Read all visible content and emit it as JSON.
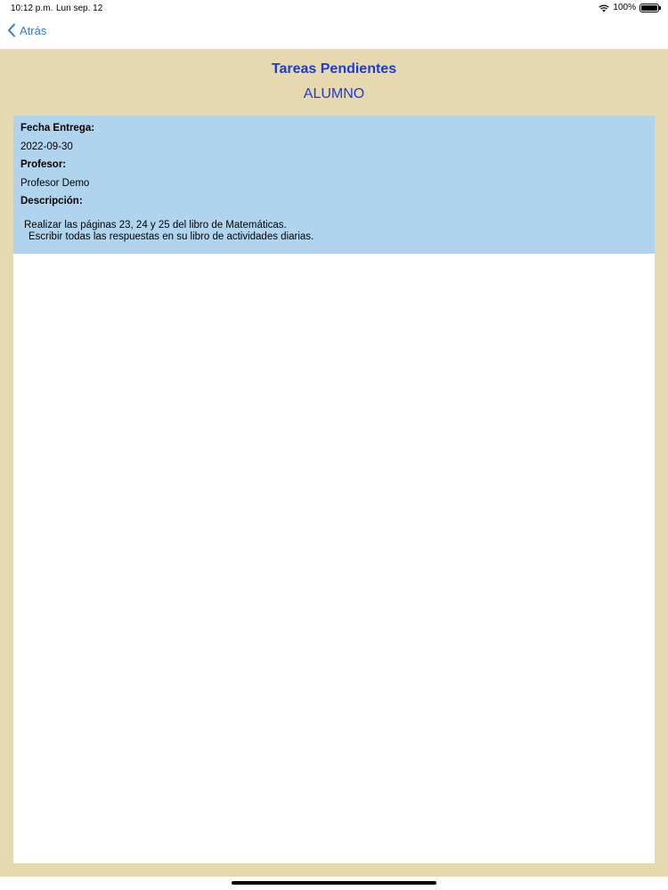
{
  "status_bar": {
    "time": "10:12 p.m.",
    "date": "Lun sep. 12",
    "battery": "100%",
    "battery_level": 1.0
  },
  "nav": {
    "back_label": "Atrás"
  },
  "header": {
    "title": "Tareas Pendientes",
    "subtitle": "ALUMNO"
  },
  "task": {
    "due_date_label": "Fecha Entrega:",
    "due_date": "2022-09-30",
    "teacher_label": "Profesor:",
    "teacher": "Profesor Demo",
    "description_label": "Descripción:",
    "description_lines": [
      "Realizar las páginas 23, 24 y 25 del libro de Matemáticas.",
      "Escribir todas las respuestas en su libro de actividades diarias."
    ]
  },
  "colors": {
    "accent": "#1b3bd6",
    "back_link": "#2a7ad6",
    "background": "#e6d9b0",
    "card": "#b0d4ee"
  }
}
